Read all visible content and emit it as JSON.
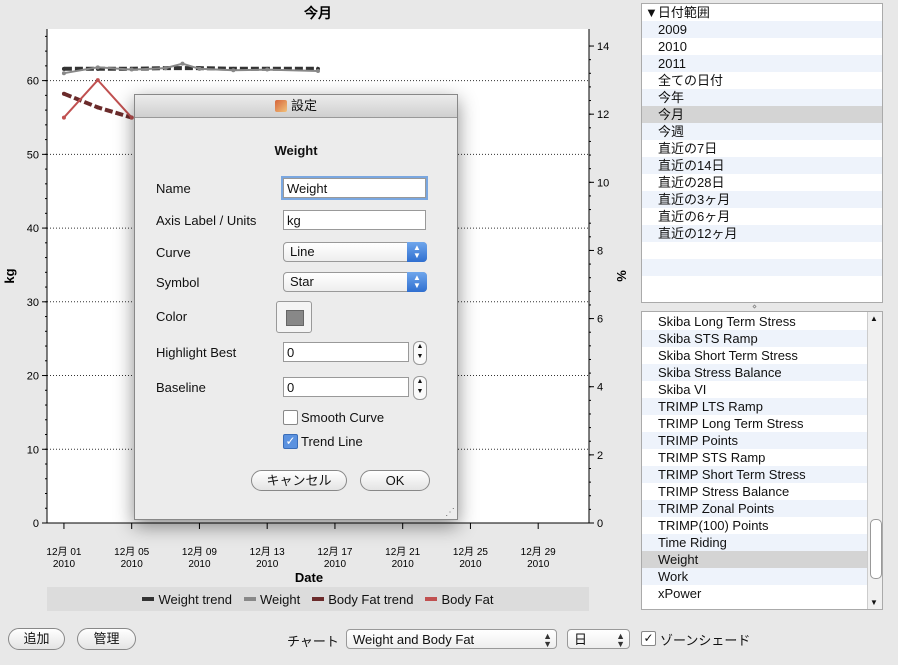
{
  "chart": {
    "title": "今月",
    "left_axis_label": "kg",
    "right_axis_label": "%",
    "x_axis_label": "Date",
    "left_ticks": [
      "0",
      "10",
      "20",
      "30",
      "40",
      "50",
      "60"
    ],
    "right_ticks": [
      "0",
      "2",
      "4",
      "6",
      "8",
      "10",
      "12",
      "14"
    ],
    "x_ticks": [
      {
        "day": "12月 01",
        "year": "2010"
      },
      {
        "day": "12月 05",
        "year": "2010"
      },
      {
        "day": "12月 09",
        "year": "2010"
      },
      {
        "day": "12月 13",
        "year": "2010"
      },
      {
        "day": "12月 17",
        "year": "2010"
      },
      {
        "day": "12月 21",
        "year": "2010"
      },
      {
        "day": "12月 25",
        "year": "2010"
      },
      {
        "day": "12月 29",
        "year": "2010"
      }
    ]
  },
  "chart_data": {
    "type": "line",
    "title": "今月",
    "xlabel": "Date",
    "ylabel": "kg",
    "y2label": "%",
    "ylim": [
      0,
      67
    ],
    "y2lim": [
      0,
      14.5
    ],
    "xlim": [
      "2010-11-30",
      "2011-01-01"
    ],
    "series": [
      {
        "name": "Weight trend",
        "axis": "left",
        "color": "#333333",
        "style": "dashed",
        "x": [
          "2010-12-01",
          "2010-12-03",
          "2010-12-05",
          "2010-12-07",
          "2010-12-09",
          "2010-12-11",
          "2010-12-13",
          "2010-12-16"
        ],
        "y": [
          61.6,
          61.6,
          61.6,
          61.7,
          61.7,
          61.6,
          61.6,
          61.6
        ]
      },
      {
        "name": "Weight",
        "axis": "left",
        "color": "#888888",
        "style": "solid",
        "x": [
          "2010-12-01",
          "2010-12-03",
          "2010-12-05",
          "2010-12-07",
          "2010-12-08",
          "2010-12-09",
          "2010-12-11",
          "2010-12-13",
          "2010-12-16"
        ],
        "y": [
          61.0,
          61.8,
          61.5,
          61.7,
          62.3,
          61.6,
          61.4,
          61.5,
          61.3
        ]
      },
      {
        "name": "Body Fat trend",
        "axis": "right",
        "color": "#6b2b2b",
        "style": "dashed",
        "x": [
          "2010-12-01",
          "2010-12-03",
          "2010-12-05"
        ],
        "y": [
          12.6,
          12.2,
          11.9
        ]
      },
      {
        "name": "Body Fat",
        "axis": "right",
        "color": "#c05050",
        "style": "solid",
        "x": [
          "2010-12-01",
          "2010-12-03",
          "2010-12-05"
        ],
        "y": [
          11.9,
          13.0,
          11.9
        ]
      }
    ]
  },
  "legend": [
    {
      "label": "Weight trend",
      "color": "#333333"
    },
    {
      "label": "Weight",
      "color": "#888888"
    },
    {
      "label": "Body Fat trend",
      "color": "#6b2b2b"
    },
    {
      "label": "Body Fat",
      "color": "#c05050"
    }
  ],
  "date_range": {
    "header": "▼日付範囲",
    "items": [
      "2009",
      "2010",
      "2011",
      "全ての日付",
      "今年",
      "今月",
      "今週",
      "直近の7日",
      "直近の14日",
      "直近の28日",
      "直近の3ヶ月",
      "直近の6ヶ月",
      "直近の12ヶ月"
    ],
    "selected": "今月"
  },
  "metrics": {
    "items": [
      "Skiba Long Term Stress",
      "Skiba STS Ramp",
      "Skiba Short Term Stress",
      "Skiba Stress Balance",
      "Skiba VI",
      "TRIMP LTS Ramp",
      "TRIMP Long Term Stress",
      "TRIMP Points",
      "TRIMP STS Ramp",
      "TRIMP Short Term Stress",
      "TRIMP Stress Balance",
      "TRIMP Zonal Points",
      "TRIMP(100) Points",
      "Time Riding",
      "Weight",
      "Work",
      "xPower"
    ],
    "selected": "Weight"
  },
  "bottom": {
    "add_label": "追加",
    "manage_label": "管理",
    "chart_label": "チャート",
    "chart_select": "Weight and Body Fat",
    "period_select": "日",
    "zone_shade_label": "ゾーンシェード",
    "zone_shade_checked": true
  },
  "dialog": {
    "title": "設定",
    "heading": "Weight",
    "name_label": "Name",
    "name_value": "Weight",
    "axis_label": "Axis Label / Units",
    "axis_value": "kg",
    "curve_label": "Curve",
    "curve_value": "Line",
    "symbol_label": "Symbol",
    "symbol_value": "Star",
    "color_label": "Color",
    "color_value": "#888888",
    "highlight_label": "Highlight Best",
    "highlight_value": "0",
    "baseline_label": "Baseline",
    "baseline_value": "0",
    "smooth_label": "Smooth Curve",
    "smooth_checked": false,
    "trend_label": "Trend Line",
    "trend_checked": true,
    "cancel_label": "キャンセル",
    "ok_label": "OK"
  },
  "icons": {
    "dialog_app": "app-icon",
    "resize": "resize-grip-icon"
  }
}
